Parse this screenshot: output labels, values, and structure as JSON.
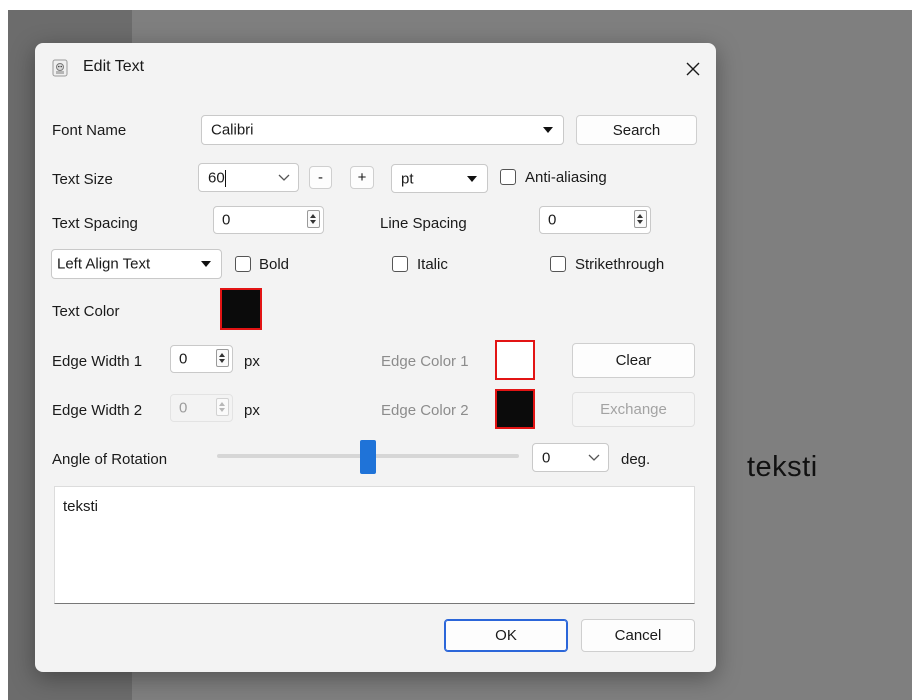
{
  "background_canvas_text": "teksti",
  "dialog": {
    "title": "Edit Text",
    "close_glyph": "✕"
  },
  "font": {
    "label": "Font Name",
    "value": "Calibri",
    "search_label": "Search"
  },
  "text_size": {
    "label": "Text Size",
    "value": "60",
    "minus_label": "-",
    "plus_label": "+",
    "unit": "pt",
    "anti_alias_label": "Anti-aliasing",
    "anti_alias_checked": false
  },
  "spacing": {
    "text_label": "Text Spacing",
    "text_value": "0",
    "line_label": "Line Spacing",
    "line_value": "0"
  },
  "style": {
    "align_value": "Left Align Text",
    "bold_label": "Bold",
    "italic_label": "Italic",
    "strike_label": "Strikethrough"
  },
  "colors": {
    "text_label": "Text Color",
    "text_color": "#0b0b0b",
    "edge1_color": "#ffffff",
    "edge2_color": "#0b0b0b",
    "swatch_border": "#e21414"
  },
  "edge1": {
    "label": "Edge Width 1",
    "value": "0",
    "unit": "px",
    "color_label": "Edge Color 1",
    "clear_label": "Clear"
  },
  "edge2": {
    "label": "Edge Width 2",
    "value": "0",
    "unit": "px",
    "color_label": "Edge Color 2",
    "exchange_label": "Exchange"
  },
  "rotation": {
    "label": "Angle of Rotation",
    "value": "0",
    "unit": "deg.",
    "slider_fraction": 0.5
  },
  "text_content": "teksti",
  "footer": {
    "ok_label": "OK",
    "cancel_label": "Cancel"
  }
}
